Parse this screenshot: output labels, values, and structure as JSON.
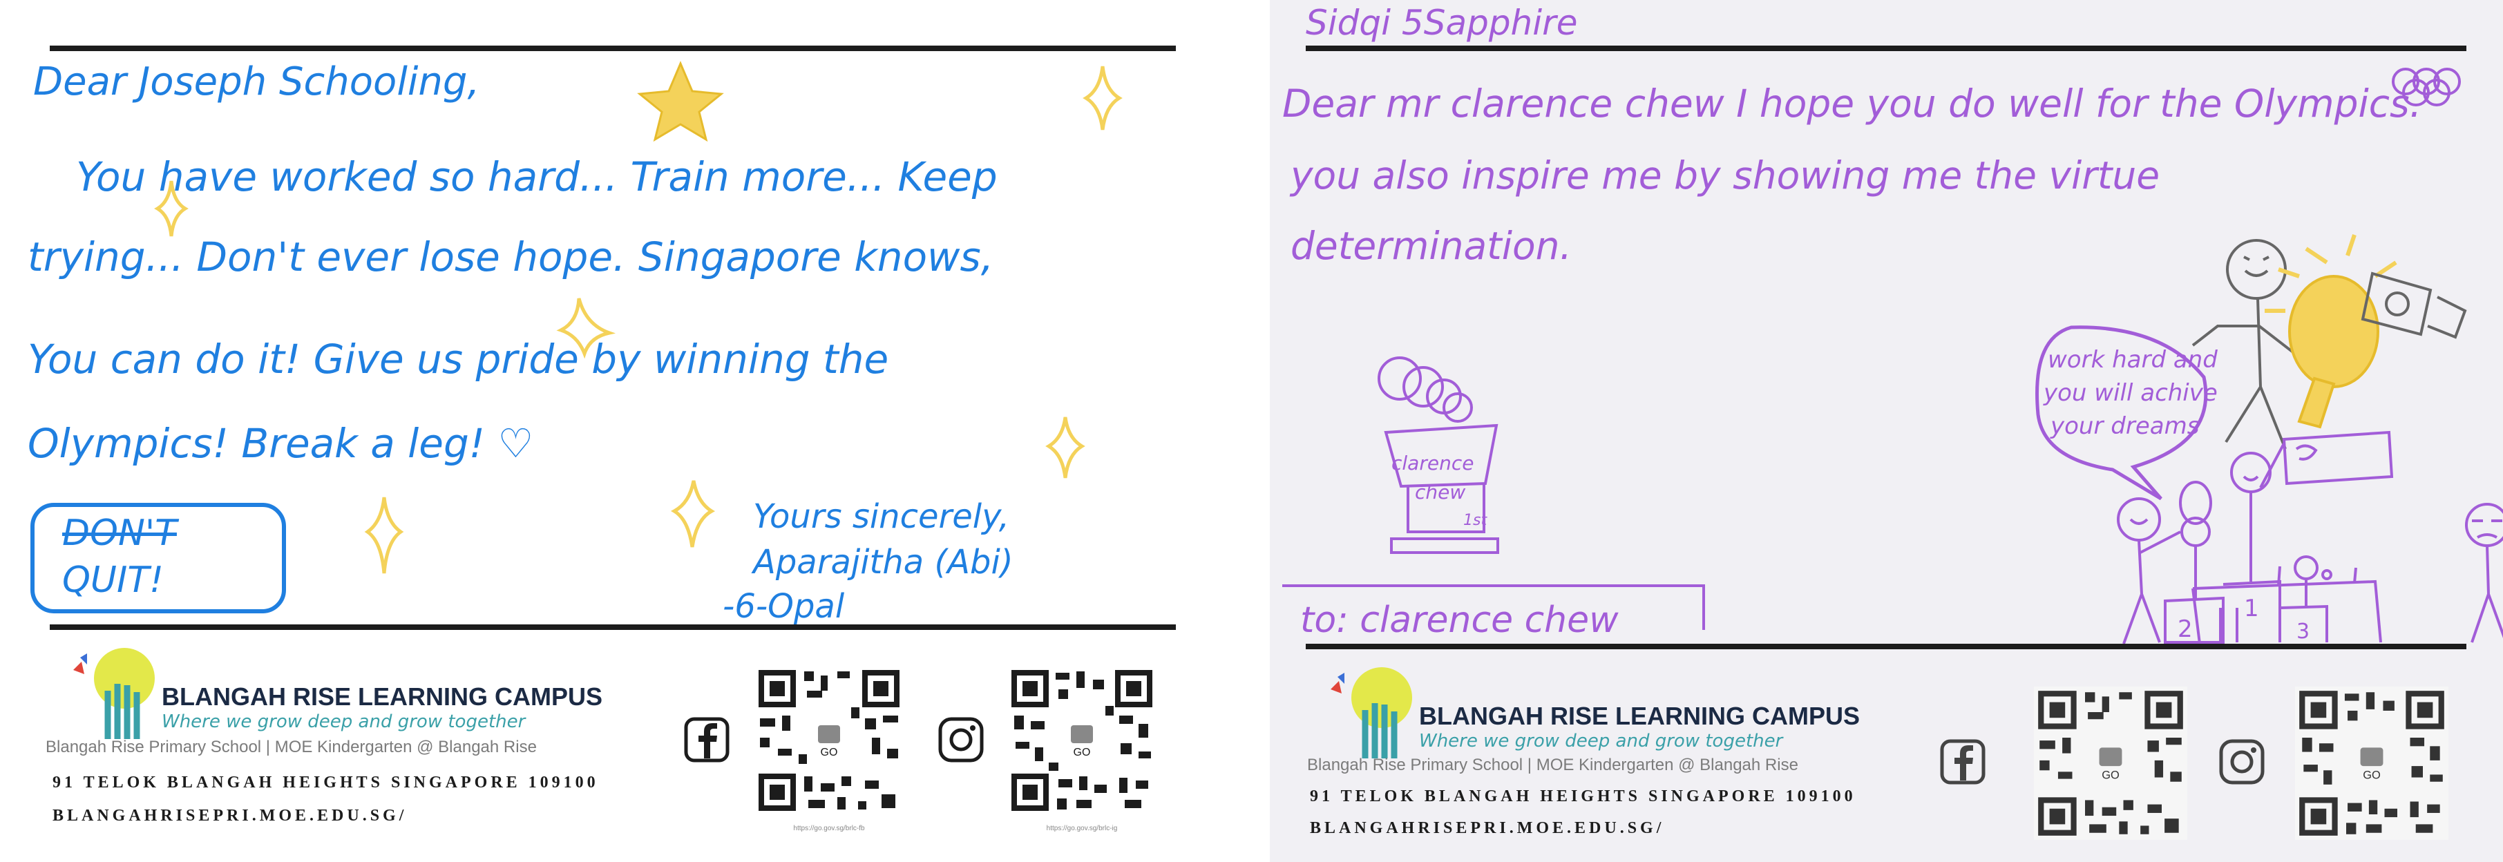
{
  "left_card": {
    "letter_lines": [
      "Dear Joseph Schooling,",
      "You have worked so hard... Train more... Keep",
      "trying... Don't ever lose hope. Singapore knows,",
      "You can do it! Give us pride by winning the",
      "Olympics! Break a leg! ♡"
    ],
    "badge": [
      "DON'T",
      "QUIT!"
    ],
    "signoff": [
      "Yours sincerely,",
      "Aparajitha (Abi)",
      "-6-Opal"
    ]
  },
  "right_card": {
    "student_tag": "Sidqi 5Sapphire",
    "letter_lines": [
      "Dear mr clarence chew I hope you do well for the Olympics.",
      "you also inspire me by showing me the virtue",
      "determination."
    ],
    "speech_bubble": [
      "work hard and",
      "you will achive",
      "your dreams"
    ],
    "trophy_label": [
      "clarence",
      "chew",
      "1st"
    ],
    "podium_numbers": [
      "2",
      "1",
      "3"
    ],
    "to_line": "to: clarence chew"
  },
  "footer": {
    "brand": "BLANGAH RISE LEARNING CAMPUS",
    "tagline": "Where we grow deep and grow together",
    "schools": "Blangah Rise Primary School | MOE Kindergarten @ Blangah Rise",
    "address": "91 TELOK BLANGAH HEIGHTS SINGAPORE 109100",
    "website": "BLANGAHRISEPRI.MOE.EDU.SG/",
    "qr_center_label": "GO",
    "qr_captions": [
      "https://go.gov.sg/brlc-fb",
      "https://go.gov.sg/brlc-ig"
    ],
    "icons": [
      "facebook-icon",
      "instagram-icon",
      "qr-code-icon",
      "campus-logo"
    ]
  },
  "colors": {
    "left_ink": "#1f7fe0",
    "right_ink": "#a25dd8",
    "sparkle_yellow": "#f4d25a",
    "brand_navy": "#1b2a44",
    "tagline_teal": "#3aa0a8",
    "left_paper": "#ffffff",
    "right_paper": "#f1f0f4"
  }
}
